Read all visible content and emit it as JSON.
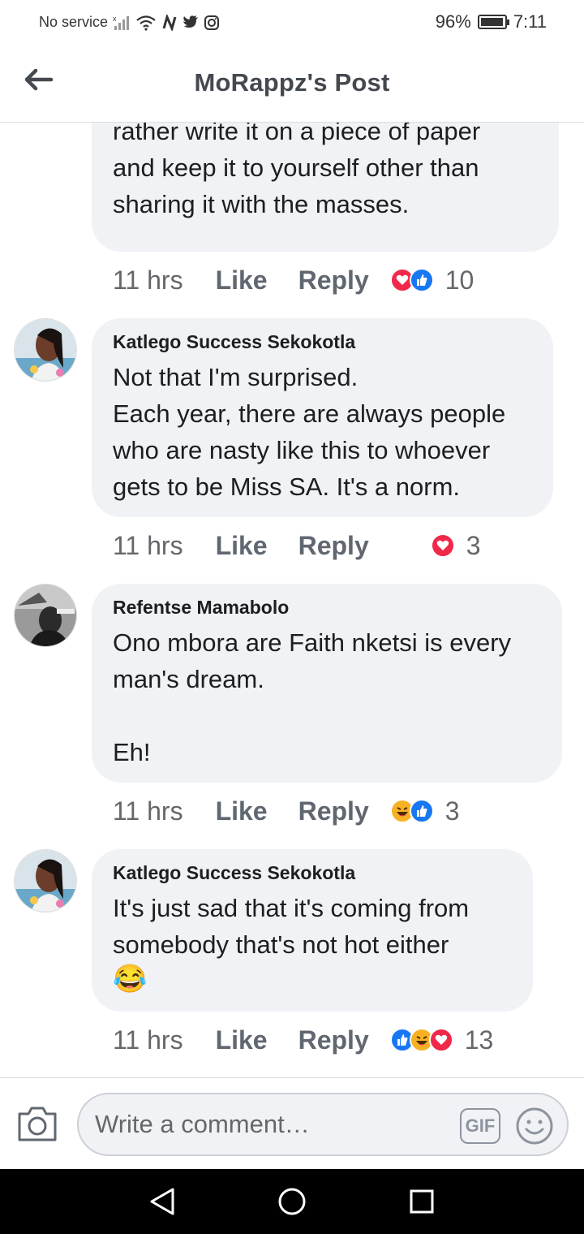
{
  "status_bar": {
    "carrier": "No service",
    "battery": "96%",
    "battery_level": 0.96,
    "time": "7:11"
  },
  "header": {
    "title": "MoRappz's Post",
    "back_icon": "arrow-left-icon"
  },
  "comments": [
    {
      "author": "",
      "text": "rather write it on a piece of paper\nand keep it to yourself other than\nsharing it with the masses.",
      "time": "11 hrs",
      "like_label": "Like",
      "reply_label": "Reply",
      "reactions": [
        "love",
        "like"
      ],
      "reaction_count": "10"
    },
    {
      "author": "Katlego Success Sekokotla",
      "text": "Not that I'm surprised.\nEach year, there are always people\nwho are nasty like this to whoever\ngets to be Miss SA. It's a norm.",
      "time": "11 hrs",
      "like_label": "Like",
      "reply_label": "Reply",
      "reactions": [
        "love"
      ],
      "reaction_count": "3"
    },
    {
      "author": "Refentse Mamabolo",
      "text": "Ono mbora are Faith nketsi is every\nman's dream.\n\nEh!",
      "time": "11 hrs",
      "like_label": "Like",
      "reply_label": "Reply",
      "reactions": [
        "haha",
        "like"
      ],
      "reaction_count": "3"
    },
    {
      "author": "Katlego Success Sekokotla",
      "text": "It's just sad that it's coming from\nsomebody that's not hot either",
      "emoji": "😂",
      "time": "11 hrs",
      "like_label": "Like",
      "reply_label": "Reply",
      "reactions": [
        "like",
        "haha",
        "love"
      ],
      "reaction_count": "13"
    }
  ],
  "composer": {
    "placeholder": "Write a comment…",
    "gif_label": "GIF"
  },
  "colors": {
    "bubble": "#f0f2f5",
    "love": "#f0284a",
    "like": "#1877f2",
    "haha": "#f7b125"
  }
}
